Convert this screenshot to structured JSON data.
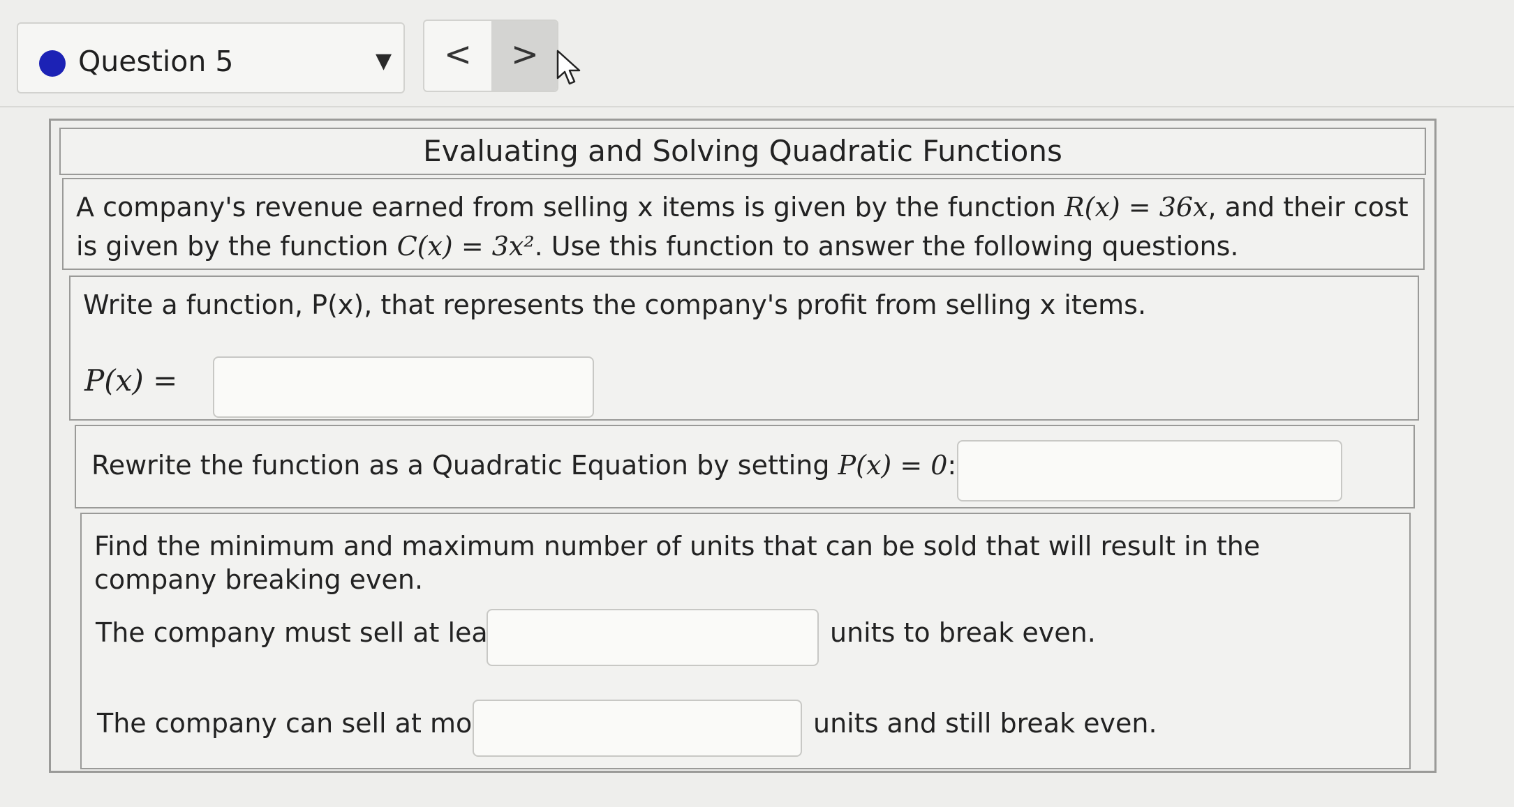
{
  "nav": {
    "question_label": "Question 5",
    "prev_glyph": "<",
    "next_glyph": ">"
  },
  "problem": {
    "title": "Evaluating and Solving Quadratic Functions",
    "intro_a": "A company's revenue earned from selling x items is given by the function ",
    "revenue_fn": "R(x) = 36x",
    "intro_b": ", and their cost is given by the function ",
    "cost_fn": "C(x) = 3x²",
    "intro_c": ". Use this function to answer the following questions.",
    "part1_prompt": "Write a function, P(x), that represents the company's profit from selling x items.",
    "part1_label": "P(x) =",
    "part1_value": "",
    "part2_prompt_a": "Rewrite the function as a Quadratic Equation by setting ",
    "part2_prompt_math": "P(x) = 0",
    "part2_prompt_b": ":",
    "part2_value": "",
    "part3_prompt": "Find the minimum and maximum number of units that can be sold that will result in the company breaking even.",
    "min_label": "The company must sell at least",
    "min_value": "",
    "min_suffix": "units to break even.",
    "max_label": "The company can sell at most",
    "max_value": "",
    "max_suffix": "units and still break even."
  },
  "colors": {
    "status_dot": "#1c22b5",
    "background": "#eeeeec",
    "border": "#9a9a98"
  },
  "icons": [
    "status-dot-icon",
    "dropdown-caret-icon",
    "mouse-cursor-icon"
  ]
}
